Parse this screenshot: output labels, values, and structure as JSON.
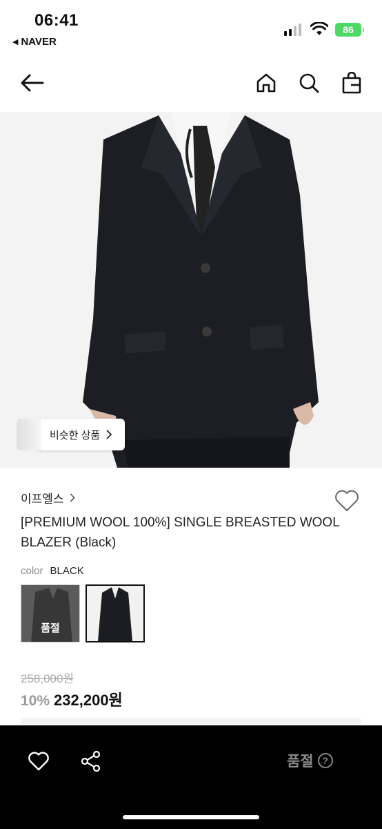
{
  "status_bar": {
    "time": "06:41",
    "back_app": "NAVER",
    "battery": "86"
  },
  "nav": {
    "back_icon": "arrow-left-icon",
    "home_icon": "home-icon",
    "search_icon": "search-icon",
    "bag_icon": "shopping-bag-icon"
  },
  "hero": {
    "similar_label": "비슷한 상품"
  },
  "product": {
    "brand": "이프엘스",
    "title": "[PREMIUM WOOL 100%] SINGLE BREASTED WOOL BLAZER (Black)",
    "color_label": "color",
    "color_value": "BLACK",
    "swatches": [
      {
        "badge": "품절"
      },
      {
        "badge": ""
      }
    ],
    "original_price": "258,000원",
    "discount_rate": "10%",
    "sale_price": "232,200원"
  },
  "bottom_bar": {
    "wish_icon": "heart-icon",
    "share_icon": "share-icon",
    "soldout_label": "품절",
    "help_label": "?"
  },
  "colors": {
    "bottom_bar_bg": "#000000",
    "battery": "#4cd964"
  }
}
